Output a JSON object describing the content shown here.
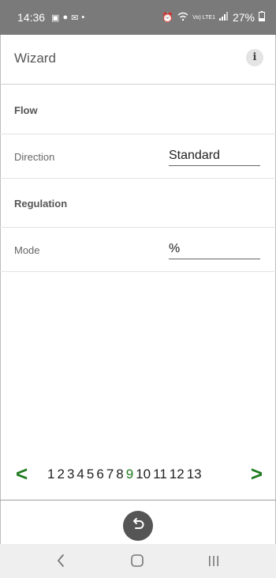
{
  "status_bar": {
    "time": "14:36",
    "battery_text": "27%",
    "network_label": "Vo) LTE1"
  },
  "header": {
    "title": "Wizard",
    "info_icon": "i"
  },
  "sections": [
    {
      "label": "Flow",
      "field_label": "Direction",
      "field_value": "Standard"
    },
    {
      "label": "Regulation",
      "field_label": "Mode",
      "field_value": "%"
    }
  ],
  "pagination": {
    "prev": "<",
    "next": ">",
    "pages": [
      "1",
      "2",
      "3",
      "4",
      "5",
      "6",
      "7",
      "8",
      "9",
      "10",
      "11",
      "12",
      "13"
    ],
    "current": "9"
  },
  "colors": {
    "accent": "#1e7a1e",
    "status_bar": "#7a7a7a",
    "fab": "#555555"
  },
  "icons": [
    "gallery-icon",
    "messenger-icon",
    "mail-icon",
    "alarm-icon",
    "wifi-icon",
    "signal-icon",
    "battery-icon",
    "undo-icon",
    "back-nav-icon",
    "home-nav-icon",
    "recents-nav-icon"
  ]
}
